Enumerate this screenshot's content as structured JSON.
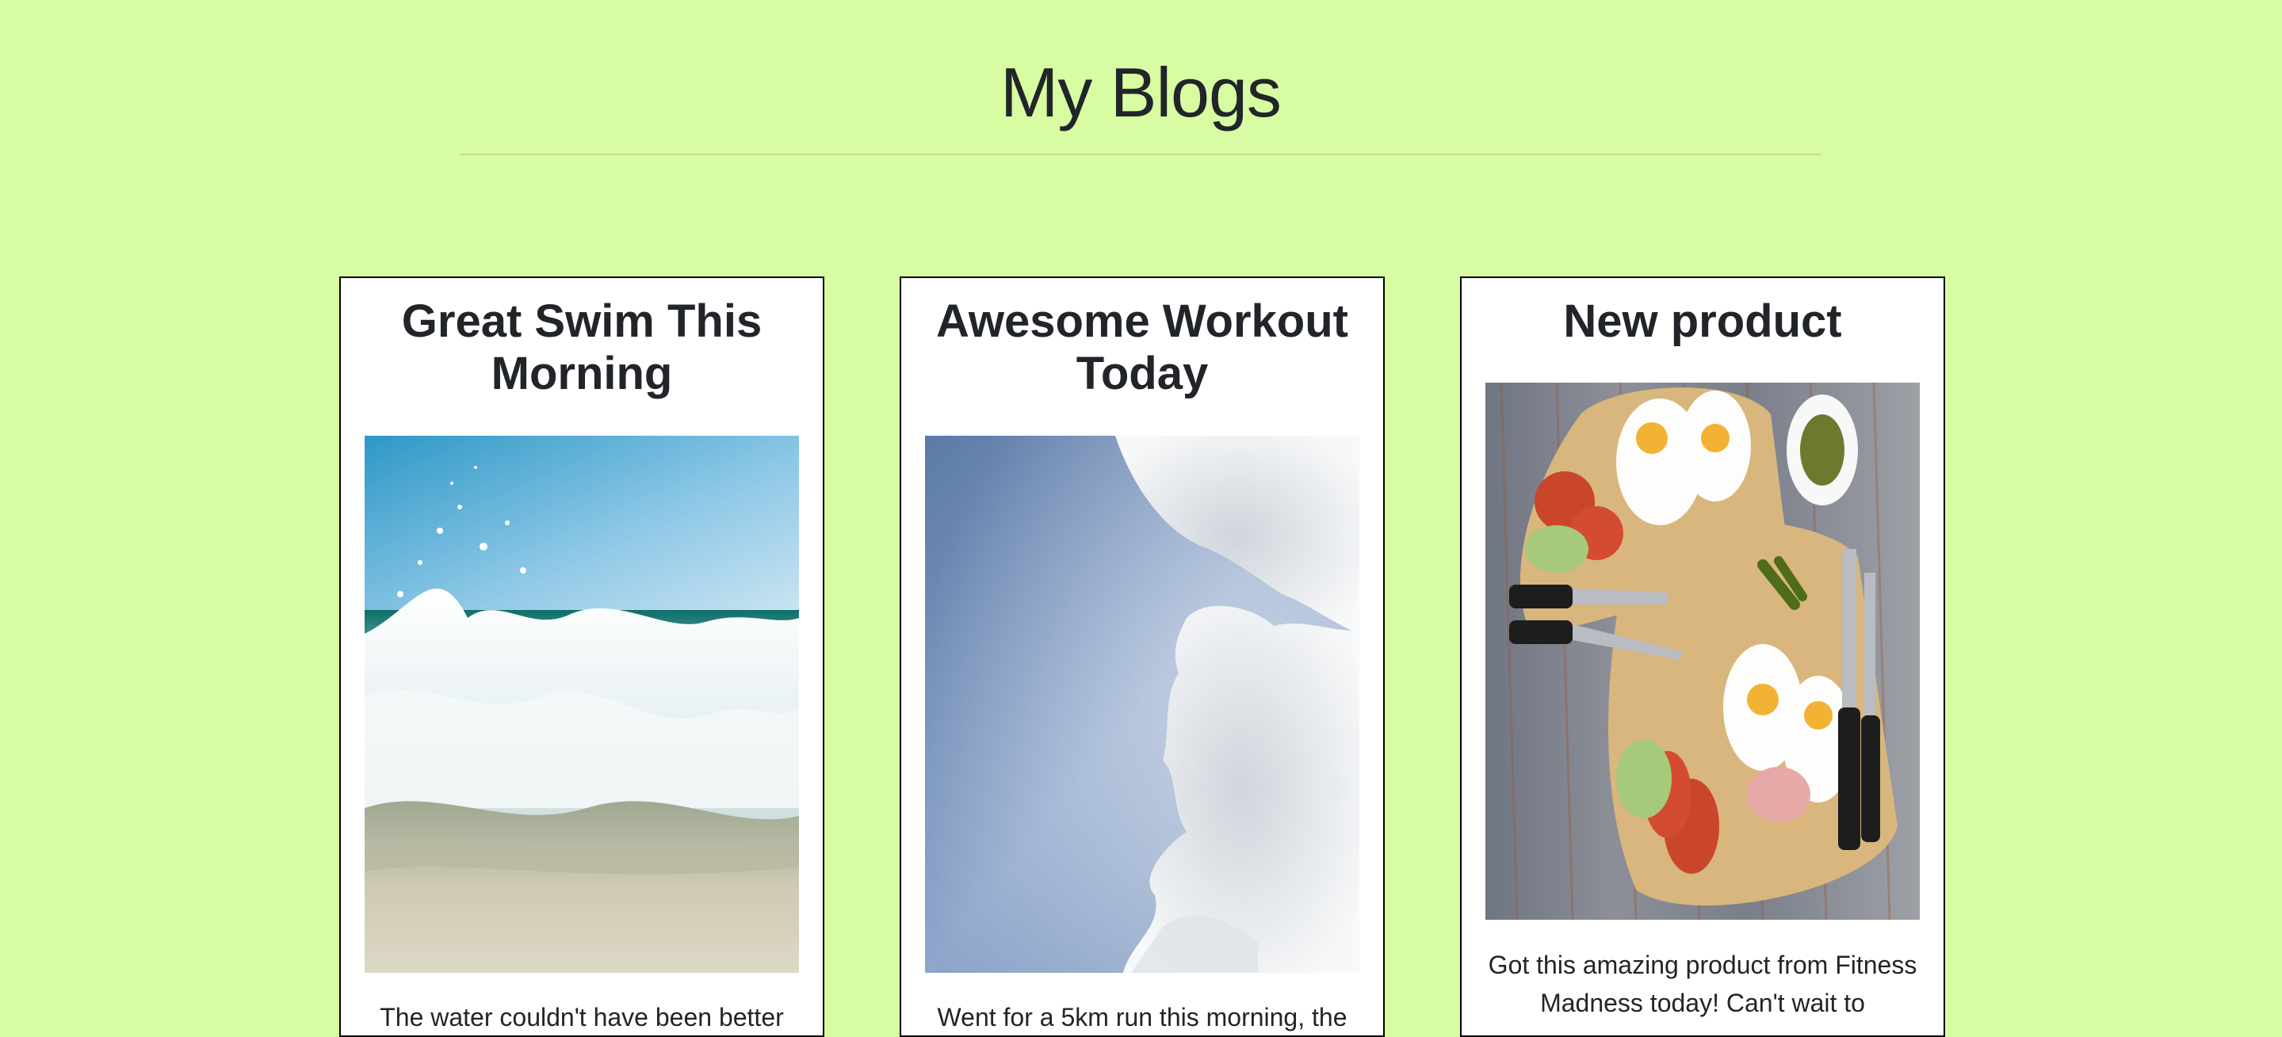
{
  "header": {
    "title": "My Blogs"
  },
  "posts": [
    {
      "title": "Great Swim This Morning",
      "image_icon": "ocean-wave-photo",
      "text": "The water couldn't have been better"
    },
    {
      "title": "Awesome Workout Today",
      "image_icon": "cloud-sky-photo",
      "text": "Went for a 5km run this morning, the"
    },
    {
      "title": "New product",
      "image_icon": "breakfast-board-photo",
      "text": "Got this amazing product from Fitness Madness today! Can't wait to"
    }
  ],
  "colors": {
    "page_background": "#d8fca1",
    "card_background": "#ffffff",
    "card_border": "#000000",
    "text": "#212529"
  }
}
